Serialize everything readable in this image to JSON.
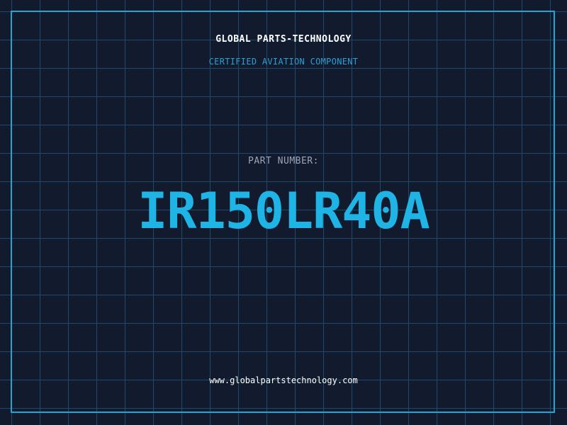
{
  "header": {
    "company_name": "GLOBAL PARTS-TECHNOLOGY",
    "tagline": "CERTIFIED AVIATION COMPONENT"
  },
  "part": {
    "label": "PART NUMBER:",
    "number": "IR150LR40A"
  },
  "footer": {
    "website": "www.globalpartstechnology.com"
  },
  "colors": {
    "background": "#121a2e",
    "grid": "#1e4a66",
    "border": "#1ea6d6",
    "accent": "#1eb4e6",
    "tagline": "#2b9fd4",
    "label": "#9aa6b6",
    "text": "#ffffff"
  }
}
